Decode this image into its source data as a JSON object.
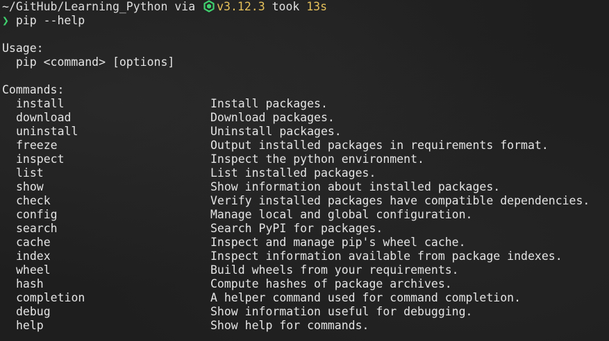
{
  "prompt": {
    "cwd": "~/GitHub/Learning_Python",
    "via": " via ",
    "runtime_icon": "nodejs-hexagon-icon",
    "version": "v3.12.3",
    "took_label": " took ",
    "took_value": "13s",
    "arrow": "❯",
    "command": " pip --help"
  },
  "usage": {
    "heading": "Usage:",
    "syntax": "  pip <command> [options]"
  },
  "commands": {
    "heading": "Commands:",
    "items": [
      {
        "name": "install",
        "desc": "Install packages."
      },
      {
        "name": "download",
        "desc": "Download packages."
      },
      {
        "name": "uninstall",
        "desc": "Uninstall packages."
      },
      {
        "name": "freeze",
        "desc": "Output installed packages in requirements format."
      },
      {
        "name": "inspect",
        "desc": "Inspect the python environment."
      },
      {
        "name": "list",
        "desc": "List installed packages."
      },
      {
        "name": "show",
        "desc": "Show information about installed packages."
      },
      {
        "name": "check",
        "desc": "Verify installed packages have compatible dependencies."
      },
      {
        "name": "config",
        "desc": "Manage local and global configuration."
      },
      {
        "name": "search",
        "desc": "Search PyPI for packages."
      },
      {
        "name": "cache",
        "desc": "Inspect and manage pip's wheel cache."
      },
      {
        "name": "index",
        "desc": "Inspect information available from package indexes."
      },
      {
        "name": "wheel",
        "desc": "Build wheels from your requirements."
      },
      {
        "name": "hash",
        "desc": "Compute hashes of package archives."
      },
      {
        "name": "completion",
        "desc": "A helper command used for command completion."
      },
      {
        "name": "debug",
        "desc": "Show information useful for debugging."
      },
      {
        "name": "help",
        "desc": "Show help for commands."
      }
    ]
  },
  "colors": {
    "background": "#1e1e1e",
    "text": "#e4e4e4",
    "version": "#e5c05b",
    "prompt_arrow": "#3fd16e",
    "icon": "#3fd16e"
  }
}
